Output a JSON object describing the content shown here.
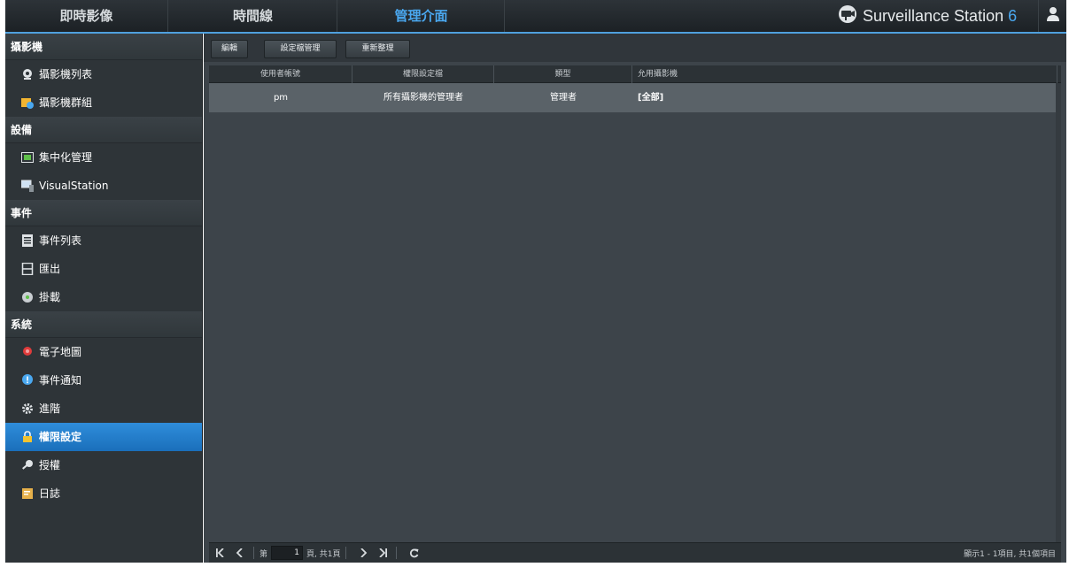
{
  "topnav": {
    "tabs": [
      {
        "label": "即時影像"
      },
      {
        "label": "時間線"
      },
      {
        "label": "管理介面"
      }
    ],
    "brand": {
      "name": "Surveillance Station",
      "version": "6"
    }
  },
  "sidebar": {
    "sections": [
      {
        "title": "攝影機",
        "items": [
          {
            "label": "攝影機列表"
          },
          {
            "label": "攝影機群組"
          }
        ]
      },
      {
        "title": "設備",
        "items": [
          {
            "label": "集中化管理"
          },
          {
            "label": "VisualStation"
          }
        ]
      },
      {
        "title": "事件",
        "items": [
          {
            "label": "事件列表"
          },
          {
            "label": "匯出"
          },
          {
            "label": "掛載"
          }
        ]
      },
      {
        "title": "系統",
        "items": [
          {
            "label": "電子地圖"
          },
          {
            "label": "事件通知"
          },
          {
            "label": "進階"
          },
          {
            "label": "權限設定"
          },
          {
            "label": "授權"
          },
          {
            "label": "日誌"
          }
        ]
      }
    ]
  },
  "toolbar": {
    "edit_label": "編輯",
    "profile_label": "設定檔管理",
    "refresh_label": "重新整理"
  },
  "table": {
    "columns": [
      "使用者帳號",
      "權限設定檔",
      "類型",
      "允用攝影機"
    ],
    "rows": [
      {
        "user": "pm",
        "profile": "所有攝影機的管理者",
        "type": "管理者",
        "cameras": "[全部]"
      }
    ]
  },
  "pager": {
    "page_prefix": "第",
    "page_value": "1",
    "page_suffix": "頁, 共1頁",
    "info": "顯示1 - 1項目, 共1個項目"
  },
  "colors": {
    "accent": "#2f8ddb",
    "active_tab": "#4aa8f0"
  }
}
